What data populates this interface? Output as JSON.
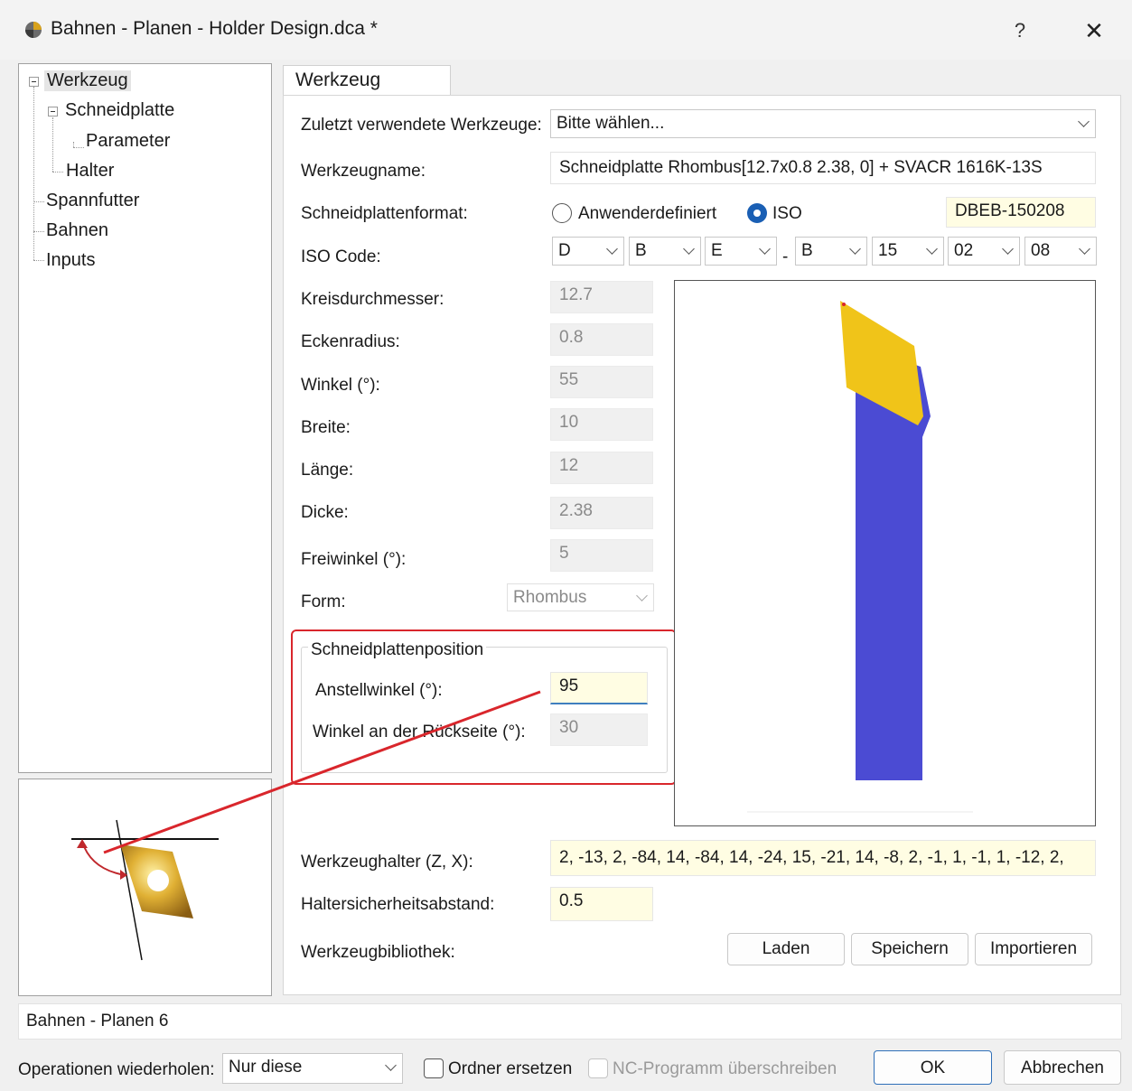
{
  "window": {
    "title": "Bahnen - Planen - Holder Design.dca *",
    "help_label": "?",
    "close_label": "✕"
  },
  "tree": {
    "items": [
      {
        "label": "Werkzeug"
      },
      {
        "label": "Schneidplatte"
      },
      {
        "label": "Parameter"
      },
      {
        "label": "Halter"
      },
      {
        "label": "Spannfutter"
      },
      {
        "label": "Bahnen"
      },
      {
        "label": "Inputs"
      }
    ]
  },
  "tab": {
    "label": "Werkzeug"
  },
  "form": {
    "recent_tools": {
      "label": "Zuletzt verwendete Werkzeuge:",
      "value": "Bitte wählen..."
    },
    "tool_name": {
      "label": "Werkzeugname:",
      "value": "Schneidplatte Rhombus[12.7x0.8 2.38, 0] + SVACR 1616K-13S"
    },
    "insert_format": {
      "label": "Schneidplattenformat:",
      "option_custom": "Anwenderdefiniert",
      "option_iso": "ISO",
      "selected": "ISO",
      "code": "DBEB-150208"
    },
    "iso_code": {
      "label": "ISO Code:",
      "parts": [
        "D",
        "B",
        "E",
        "B",
        "15",
        "02",
        "08"
      ],
      "separator": "-"
    },
    "circle_diameter": {
      "label": "Kreisdurchmesser:",
      "value": "12.7"
    },
    "corner_radius": {
      "label": "Eckenradius:",
      "value": "0.8"
    },
    "angle": {
      "label": "Winkel (°):",
      "value": "55"
    },
    "width": {
      "label": "Breite:",
      "value": "10"
    },
    "length": {
      "label": "Länge:",
      "value": "12"
    },
    "thickness": {
      "label": "Dicke:",
      "value": "2.38"
    },
    "clearance_angle": {
      "label": "Freiwinkel  (°):",
      "value": "5"
    },
    "shape": {
      "label": "Form:",
      "value": "Rhombus"
    },
    "position_group": {
      "title": "Schneidplattenposition",
      "lead_angle": {
        "label": "Anstellwinkel (°):",
        "value": "95"
      },
      "back_angle": {
        "label": "Winkel an der Rückseite (°):",
        "value": "30"
      }
    },
    "holder": {
      "label": "Werkzeughalter (Z, X):",
      "value": "2, -13, 2, -84, 14, -84, 14, -24, 15, -21, 14, -8, 2, -1, 1, -1, 1, -12, 2,"
    },
    "holder_clearance": {
      "label": "Haltersicherheitsabstand:",
      "value": "0.5"
    },
    "library": {
      "label": "Werkzeugbibliothek:",
      "load": "Laden",
      "save": "Speichern",
      "import": "Importieren"
    }
  },
  "status": {
    "text": "Bahnen - Planen 6"
  },
  "footer": {
    "repeat_label": "Operationen wiederholen:",
    "repeat_value": "Nur diese",
    "replace_folder": "Ordner ersetzen",
    "overwrite_nc": "NC-Programm überschreiben",
    "ok": "OK",
    "cancel": "Abbrechen"
  },
  "colors": {
    "insert_gold": "#f0c419",
    "holder_blue": "#4b4bd3",
    "highlight_red": "#d9262c",
    "radio_blue": "#1a5fb4"
  }
}
